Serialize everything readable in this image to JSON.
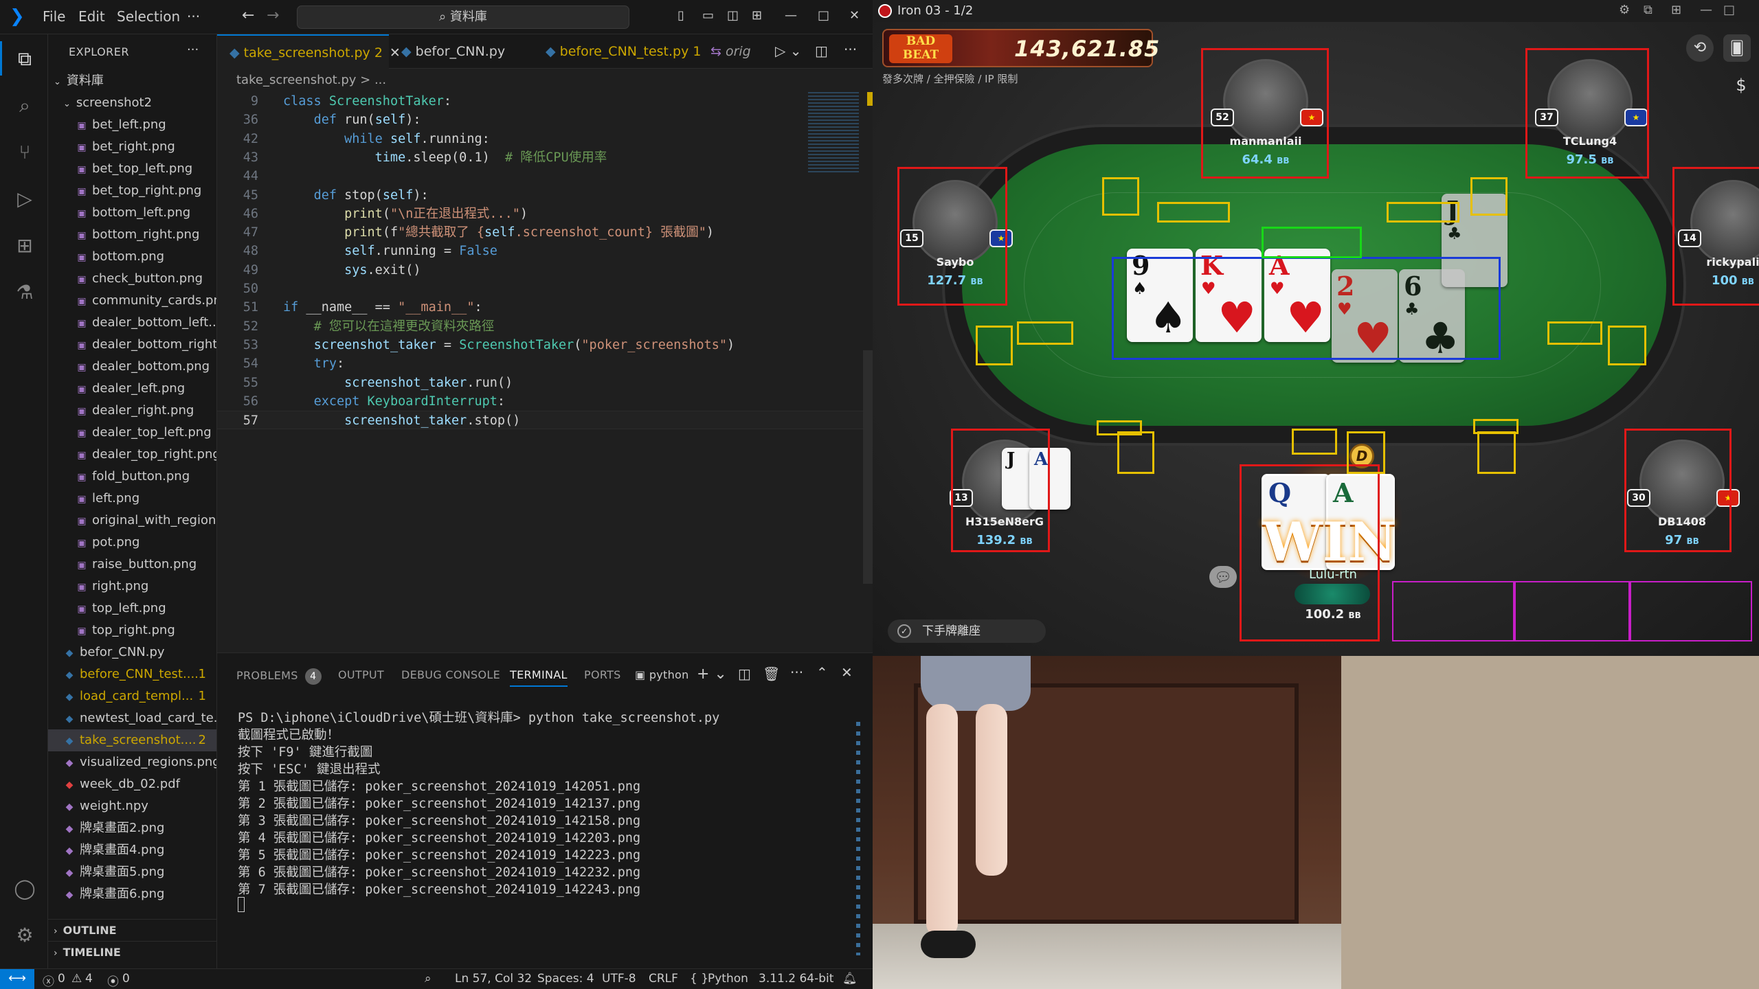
{
  "vscode": {
    "menu": [
      "File",
      "Edit",
      "Selection",
      "···"
    ],
    "search_text": "⌕ 資料庫",
    "explorer_title": "EXPLORER",
    "explorer_more": "···",
    "root_folder": "資料庫",
    "subfolder": "screenshot2",
    "folder_files": [
      "bet_left.png",
      "bet_right.png",
      "bet_top_left.png",
      "bet_top_right.png",
      "bottom_left.png",
      "bottom_right.png",
      "bottom.png",
      "check_button.png",
      "community_cards.png",
      "dealer_bottom_left....",
      "dealer_bottom_right...",
      "dealer_bottom.png",
      "dealer_left.png",
      "dealer_right.png",
      "dealer_top_left.png",
      "dealer_top_right.png",
      "fold_button.png",
      "left.png",
      "original_with_region...",
      "pot.png",
      "raise_button.png",
      "right.png",
      "top_left.png",
      "top_right.png"
    ],
    "root_files": [
      {
        "name": "befor_CNN.py",
        "badge": "",
        "color": "#cccccc"
      },
      {
        "name": "before_CNN_test....",
        "badge": "1",
        "color": "#cca700"
      },
      {
        "name": "load_card_templ...",
        "badge": "1",
        "color": "#cca700"
      },
      {
        "name": "newtest_load_card_te...",
        "badge": "",
        "color": "#cccccc"
      },
      {
        "name": "take_screenshot....",
        "badge": "2",
        "color": "#cca700"
      },
      {
        "name": "visualized_regions.png",
        "badge": "",
        "color": "#cccccc"
      },
      {
        "name": "week_db_02.pdf",
        "badge": "",
        "color": "#cccccc"
      },
      {
        "name": "weight.npy",
        "badge": "",
        "color": "#cccccc"
      },
      {
        "name": "牌桌畫面2.png",
        "badge": "",
        "color": "#cccccc"
      },
      {
        "name": "牌桌畫面4.png",
        "badge": "",
        "color": "#cccccc"
      },
      {
        "name": "牌桌畫面5.png",
        "badge": "",
        "color": "#cccccc"
      },
      {
        "name": "牌桌畫面6.png",
        "badge": "",
        "color": "#cccccc"
      }
    ],
    "outline_label": "OUTLINE",
    "timeline_label": "TIMELINE",
    "tabs": [
      {
        "label": "take_screenshot.py 2",
        "active": true
      },
      {
        "label": "befor_CNN.py",
        "active": false
      },
      {
        "label": "before_CNN_test.py 1",
        "active": false
      },
      {
        "label": "orig",
        "active": false
      }
    ],
    "breadcrumb": "take_screenshot.py > ...",
    "code_lines": [
      {
        "n": "9",
        "t": "class ScreenshotTaker:"
      },
      {
        "n": "36",
        "t": "    def run(self):"
      },
      {
        "n": "42",
        "t": "        while self.running:"
      },
      {
        "n": "43",
        "t": "            time.sleep(0.1)  # 降低CPU使用率"
      },
      {
        "n": "44",
        "t": ""
      },
      {
        "n": "45",
        "t": "    def stop(self):"
      },
      {
        "n": "46",
        "t": "        print(\"\\n正在退出程式...\")"
      },
      {
        "n": "47",
        "t": "        print(f\"總共截取了 {self.screenshot_count} 張截圖\")"
      },
      {
        "n": "48",
        "t": "        self.running = False"
      },
      {
        "n": "49",
        "t": "        sys.exit()"
      },
      {
        "n": "50",
        "t": ""
      },
      {
        "n": "51",
        "t": "if __name__ == \"__main__\":"
      },
      {
        "n": "52",
        "t": "    # 您可以在這裡更改資料夾路徑"
      },
      {
        "n": "53",
        "t": "    screenshot_taker = ScreenshotTaker(\"poker_screenshots\")"
      },
      {
        "n": "54",
        "t": "    try:"
      },
      {
        "n": "55",
        "t": "        screenshot_taker.run()"
      },
      {
        "n": "56",
        "t": "    except KeyboardInterrupt:"
      },
      {
        "n": "57",
        "t": "        screenshot_taker.stop()"
      }
    ],
    "panel_tabs": [
      "PROBLEMS",
      "OUTPUT",
      "DEBUG CONSOLE",
      "TERMINAL",
      "PORTS"
    ],
    "problems_count": "4",
    "terminal_profile": "python",
    "terminal_lines": [
      "PS D:\\iphone\\iCloudDrive\\碩士班\\資料庫> python take_screenshot.py",
      "截圖程式已啟動！",
      "按下 'F9' 鍵進行截圖",
      "按下 'ESC' 鍵退出程式",
      "第 1 張截圖已儲存: poker_screenshot_20241019_142051.png",
      "第 2 張截圖已儲存: poker_screenshot_20241019_142137.png",
      "第 3 張截圖已儲存: poker_screenshot_20241019_142158.png",
      "第 4 張截圖已儲存: poker_screenshot_20241019_142203.png",
      "第 5 張截圖已儲存: poker_screenshot_20241019_142223.png",
      "第 6 張截圖已儲存: poker_screenshot_20241019_142232.png",
      "第 7 張截圖已儲存: poker_screenshot_20241019_142243.png"
    ],
    "status": {
      "errors": "0",
      "warnings": "4",
      "ports": "0",
      "position": "Ln 57, Col 32",
      "spaces": "Spaces: 4",
      "encoding": "UTF-8",
      "eol": "CRLF",
      "language": "Python",
      "interpreter": "3.11.2 64-bit"
    }
  },
  "poker": {
    "window_title": "Iron 03 - 1/2",
    "logo_text": "BAD BEAT",
    "jackpot": "143,621.85",
    "table_info": "發多次牌 / 全押保險 / IP 限制",
    "players": [
      {
        "name": "manmanlaii",
        "stack": "64.4",
        "level": "52"
      },
      {
        "name": "TCLung4",
        "stack": "97.5",
        "level": "37"
      },
      {
        "name": "Saybo",
        "stack": "127.7",
        "level": "15"
      },
      {
        "name": "rickypali",
        "stack": "100",
        "level": "14"
      },
      {
        "name": "H315eN8erG",
        "stack": "139.2",
        "level": "13"
      },
      {
        "name": "DB1408",
        "stack": "97",
        "level": "30"
      }
    ],
    "bb_unit": "BB",
    "hero_name": "Lulu-rtn",
    "hero_stack": "100.2",
    "win_text": "WIN",
    "dealer_button": "D",
    "sit_out_label": "下手牌離座",
    "community_cards": [
      {
        "rank": "9",
        "suit": "♠",
        "color": "#111"
      },
      {
        "rank": "K",
        "suit": "♥",
        "color": "#d8161e"
      },
      {
        "rank": "A",
        "suit": "♥",
        "color": "#d8161e"
      },
      {
        "rank": "2",
        "suit": "♥",
        "color": "#d8161e"
      },
      {
        "rank": "6",
        "suit": "♣",
        "color": "#111"
      }
    ],
    "extra_card": {
      "rank": "J",
      "suit": "♣"
    },
    "h315_hand": [
      "J",
      "A"
    ],
    "hero_hand": [
      "Q",
      "A"
    ]
  }
}
